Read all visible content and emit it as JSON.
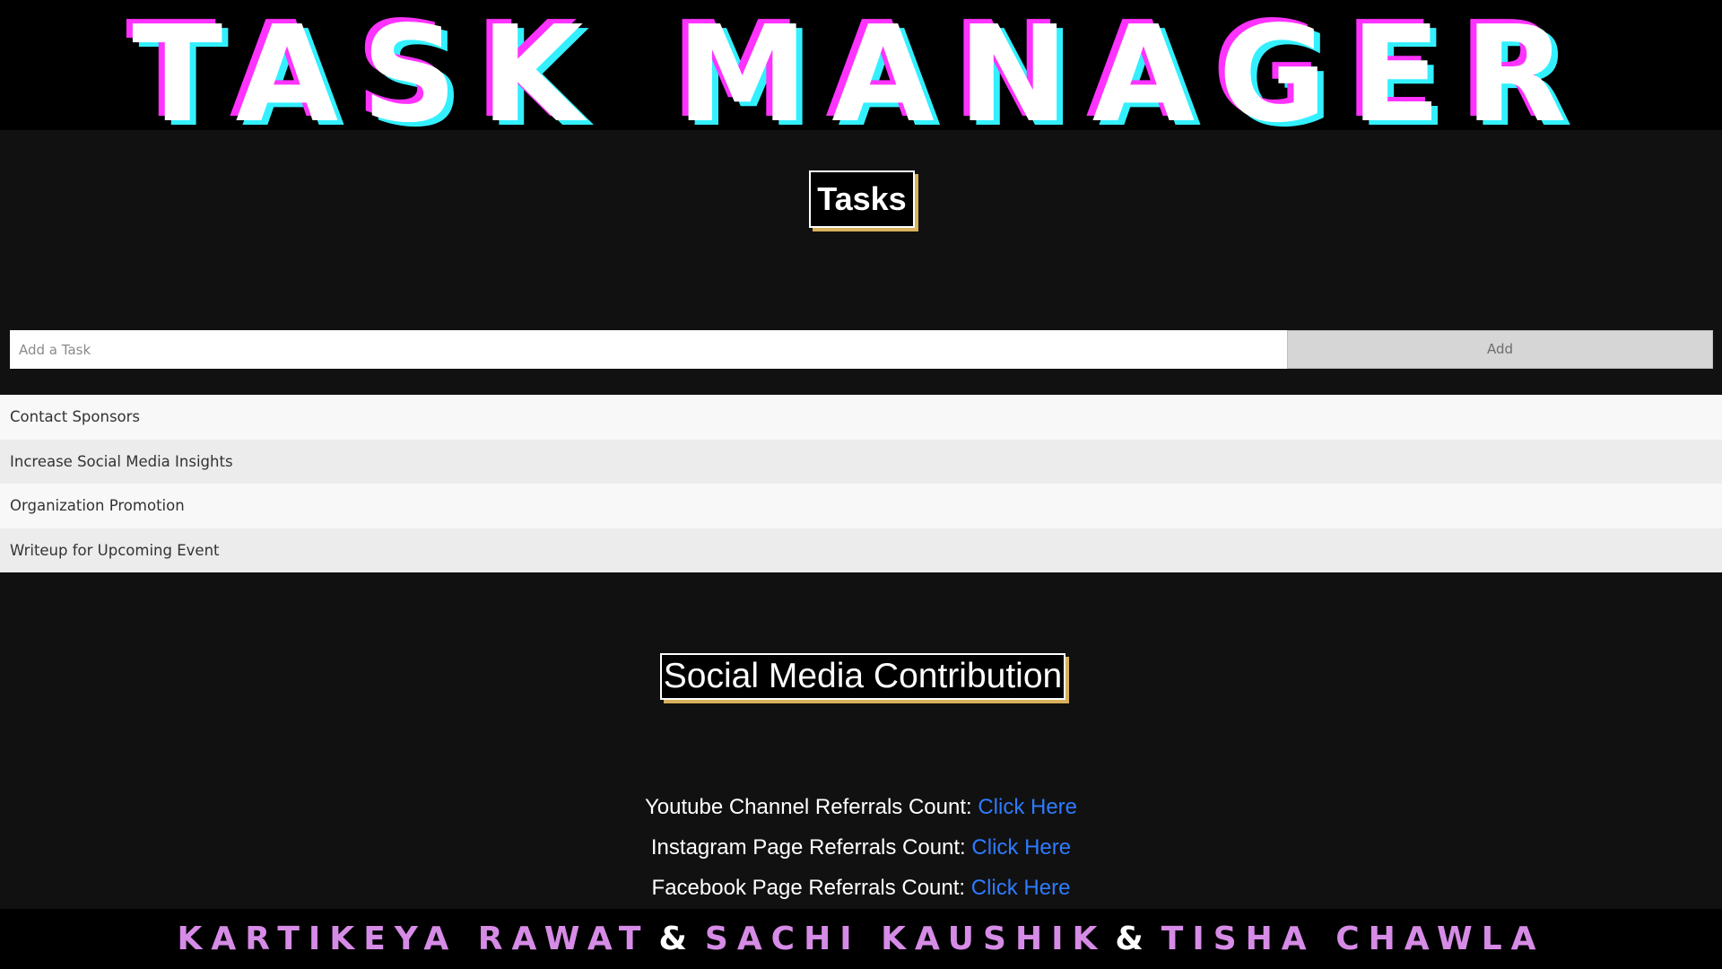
{
  "header": {
    "title": "TASK MANAGER"
  },
  "tasks_section": {
    "heading": "Tasks",
    "input_placeholder": "Add a Task",
    "add_button_label": "Add",
    "items": [
      "Contact Sponsors",
      "Increase Social Media Insights",
      "Organization Promotion",
      "Writeup for Upcoming Event"
    ]
  },
  "social_section": {
    "heading": "Social Media Contribution",
    "referrals": [
      {
        "label": "Youtube Channel Referrals Count:",
        "link_text": "Click Here"
      },
      {
        "label": "Instagram Page Referrals Count:",
        "link_text": "Click Here"
      },
      {
        "label": "Facebook Page Referrals Count:",
        "link_text": "Click Here"
      }
    ]
  },
  "footer": {
    "authors": [
      "KARTIKEYA RAWAT",
      "SACHI KAUSHIK",
      "TISHA CHAWLA"
    ],
    "separator": "&"
  },
  "colors": {
    "background": "#111111",
    "banner": "#000000",
    "title_shadow_pink": "#ff33ff",
    "title_shadow_cyan": "#33f0ff",
    "heading_accent": "#d8b15a",
    "link": "#2e7bff",
    "author_name": "#d68be6"
  }
}
